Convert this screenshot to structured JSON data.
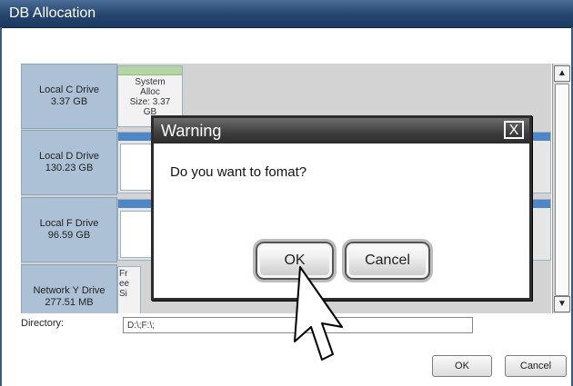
{
  "window": {
    "title": "DB Allocation"
  },
  "drives": [
    {
      "name": "Local C Drive",
      "size": "3.37 GB",
      "alloc": [
        "System",
        "Alloc",
        "Size: 3.37",
        "GB"
      ]
    },
    {
      "name": "Local D Drive",
      "size": "130.23 GB"
    },
    {
      "name": "Local F Drive",
      "size": "96.59 GB"
    },
    {
      "name": "Network Y Drive",
      "size": "277.51 MB",
      "alloc": [
        "Fr",
        "ee",
        "Si"
      ]
    }
  ],
  "directory": {
    "label": "Directory:",
    "value": "D:\\;F:\\;"
  },
  "buttons": {
    "ok": "OK",
    "cancel": "Cancel"
  },
  "dialog": {
    "title": "Warning",
    "message": "Do you want to fomat?",
    "ok": "OK",
    "cancel": "Cancel",
    "close_glyph": "X"
  },
  "scroll": {
    "up_glyph": "▲",
    "down_glyph": "▼"
  },
  "colors": {
    "titlebar": "#24456e",
    "drive_label": "#adc1d6",
    "alloc_green": "#b5d6a4",
    "alloc_blue": "#4f86c6",
    "dialog_titlebar": "#3d3d3d"
  }
}
